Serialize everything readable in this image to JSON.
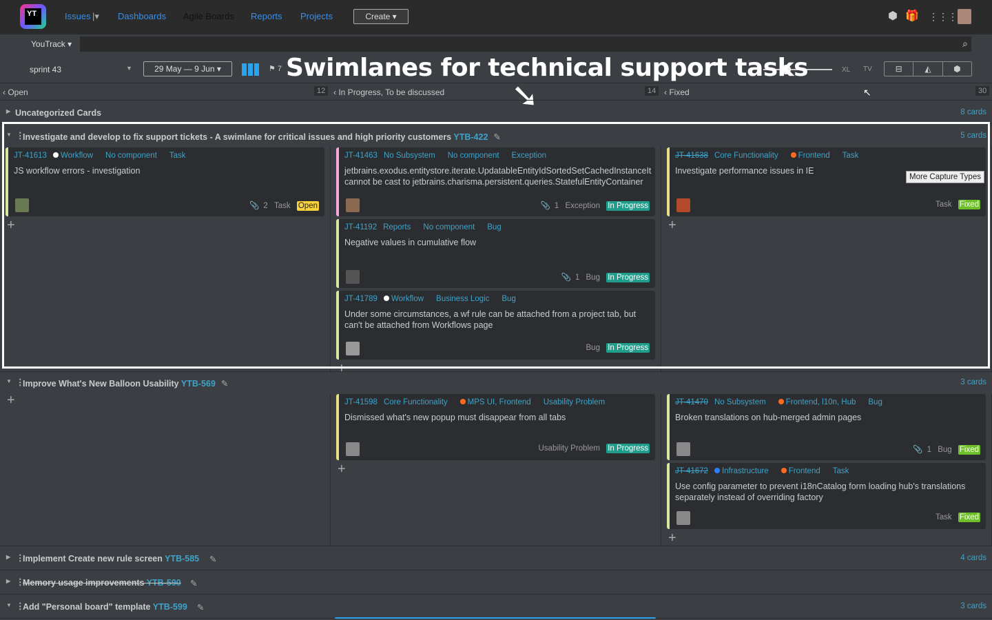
{
  "nav": {
    "logo": "YT",
    "issues": "Issues",
    "dashboards": "Dashboards",
    "agile": "Agile Boards",
    "reports": "Reports",
    "projects": "Projects",
    "create": "Create ▾"
  },
  "search": {
    "project": "YouTrack ▾",
    "value": ""
  },
  "toolbar": {
    "sprint": "sprint 43",
    "dates": "29 May — 9 Jun ▾",
    "sprint_flag": "7",
    "size_xl": "XL",
    "size_tv": "TV",
    "zoom_level": 0.15
  },
  "overlay": {
    "title": "Swimlanes for technical support tasks",
    "arrow": "➘"
  },
  "tooltip": "More Capture Types",
  "columns": [
    {
      "label": "Open",
      "count": "12"
    },
    {
      "label": "In Progress, To be discussed",
      "count": "14"
    },
    {
      "label": "Fixed",
      "count": "30"
    }
  ],
  "uncategorized": {
    "label": "Uncategorized Cards",
    "count": "8 cards"
  },
  "lanes": [
    {
      "title": "Investigate and develop to fix support tickets - A swimlane for critical issues and high priority customers",
      "id": "YTB-422",
      "count": "5 cards",
      "cols": [
        [
          {
            "id": "JT-41613",
            "done": false,
            "tags": [
              {
                "t": "Workflow",
                "dot": "#ffffff"
              },
              {
                "t": "No component"
              },
              {
                "t": "Task"
              }
            ],
            "summary": "JS workflow errors - investigation",
            "attach": "2",
            "type": "Task",
            "state": "Open",
            "stateColor": "#f7d23a",
            "stateText": "#222",
            "stripe": "#d8e7a0",
            "avatar": "#6a7a55"
          }
        ],
        [
          {
            "id": "JT-41463",
            "done": false,
            "tags": [
              {
                "t": "No Subsystem"
              },
              {
                "t": "No component"
              },
              {
                "t": "Exception"
              }
            ],
            "summary": "jetbrains.exodus.entitystore.iterate.UpdatableEntityIdSortedSetCachedInstanceIt cannot be cast to jetbrains.charisma.persistent.queries.StatefulEntityContainer",
            "attach": "1",
            "type": "Exception",
            "state": "In Progress",
            "stateColor": "#1f9e8c",
            "stateText": "#fff",
            "stripe": "#f7a8d8",
            "avatar": "#8a6a50"
          },
          {
            "id": "JT-41192",
            "done": false,
            "tags": [
              {
                "t": "Reports"
              },
              {
                "t": "No component"
              },
              {
                "t": "Bug"
              }
            ],
            "summary": "Negative values in cumulative flow",
            "attach": "1",
            "type": "Bug",
            "state": "In Progress",
            "stateColor": "#1f9e8c",
            "stateText": "#fff",
            "stripe": "#d8e7a0",
            "avatar": "#555"
          },
          {
            "id": "JT-41789",
            "done": false,
            "tags": [
              {
                "t": "Workflow",
                "dot": "#ffffff"
              },
              {
                "t": "Business Logic"
              },
              {
                "t": "Bug"
              }
            ],
            "summary": "Under some circumstances, a wf rule can be attached from a project tab, but can't be attached from Workflows page",
            "attach": "",
            "type": "Bug",
            "state": "In Progress",
            "stateColor": "#1f9e8c",
            "stateText": "#fff",
            "stripe": "#d8e7a0",
            "avatar": "#999"
          }
        ],
        [
          {
            "id": "JT-41638",
            "done": true,
            "tags": [
              {
                "t": "Core Functionality"
              },
              {
                "t": "Frontend",
                "dot": "#ff6a1f"
              },
              {
                "t": "Task"
              }
            ],
            "summary": "Investigate performance issues in IE",
            "attach": "",
            "type": "Task",
            "state": "Fixed",
            "stateColor": "#6fbf2a",
            "stateText": "#fff",
            "stripe": "#e8e084",
            "avatar": "#b04a2a"
          }
        ]
      ]
    },
    {
      "title": "Improve What's New Balloon Usability",
      "id": "YTB-569",
      "count": "3 cards",
      "cols": [
        [],
        [
          {
            "id": "JT-41598",
            "done": false,
            "tags": [
              {
                "t": "Core Functionality"
              },
              {
                "t": "MPS UI, Frontend",
                "dot": "#ff6a1f"
              },
              {
                "t": "Usability Problem"
              }
            ],
            "summary": "Dismissed what's new popup must disappear from all tabs",
            "attach": "",
            "type": "Usability Problem",
            "state": "In Progress",
            "stateColor": "#1f9e8c",
            "stateText": "#fff",
            "stripe": "#e8e084",
            "avatar": "#888"
          }
        ],
        [
          {
            "id": "JT-41470",
            "done": true,
            "tags": [
              {
                "t": "No Subsystem"
              },
              {
                "t": "Frontend, l10n, Hub",
                "dot": "#ff6a1f"
              },
              {
                "t": "Bug"
              }
            ],
            "summary": "Broken translations on hub-merged admin pages",
            "attach": "1",
            "type": "Bug",
            "state": "Fixed",
            "stateColor": "#6fbf2a",
            "stateText": "#fff",
            "stripe": "#d8e7a0",
            "avatar": "#888"
          },
          {
            "id": "JT-41672",
            "done": true,
            "tags": [
              {
                "t": "Infrastructure",
                "dot": "#2a7fff"
              },
              {
                "t": "Frontend",
                "dot": "#ff6a1f"
              },
              {
                "t": "Task"
              }
            ],
            "summary": "Use config parameter to prevent i18nCatalog form loading hub's translations separately instead of overriding factory",
            "attach": "",
            "type": "Task",
            "state": "Fixed",
            "stateColor": "#6fbf2a",
            "stateText": "#fff",
            "stripe": "#d8e7a0",
            "avatar": "#888"
          }
        ]
      ]
    }
  ],
  "collapsed": [
    {
      "title": "Implement Create new rule screen",
      "id": "YTB-585",
      "count": "4 cards",
      "done": false
    },
    {
      "title": "Memory usage improvements",
      "id": "YTB-590",
      "count": "",
      "done": true
    },
    {
      "title": "Add \"Personal board\" template",
      "id": "YTB-599",
      "count": "3 cards",
      "done": false
    }
  ]
}
